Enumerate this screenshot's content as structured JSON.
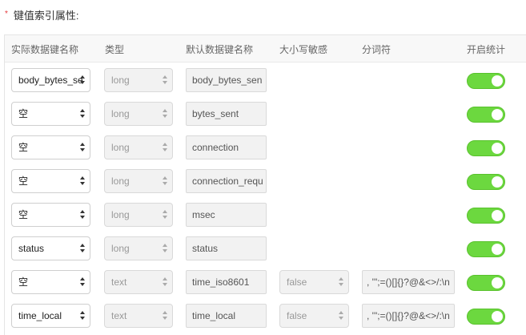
{
  "section": {
    "required_mark": "*",
    "label": "键值索引属性:"
  },
  "columns": {
    "field_name": "实际数据键名称",
    "type": "类型",
    "alias": "默认数据键名称",
    "case_sensitive": "大小写敏感",
    "delimiter": "分词符",
    "stats": "开启统计"
  },
  "rows": [
    {
      "field_name": "body_bytes_se",
      "type": "long",
      "alias": "body_bytes_sen",
      "case_sensitive": null,
      "delimiter": null,
      "stats": true
    },
    {
      "field_name": "空",
      "type": "long",
      "alias": "bytes_sent",
      "case_sensitive": null,
      "delimiter": null,
      "stats": true
    },
    {
      "field_name": "空",
      "type": "long",
      "alias": "connection",
      "case_sensitive": null,
      "delimiter": null,
      "stats": true
    },
    {
      "field_name": "空",
      "type": "long",
      "alias": "connection_requ",
      "case_sensitive": null,
      "delimiter": null,
      "stats": true
    },
    {
      "field_name": "空",
      "type": "long",
      "alias": "msec",
      "case_sensitive": null,
      "delimiter": null,
      "stats": true
    },
    {
      "field_name": "status",
      "type": "long",
      "alias": "status",
      "case_sensitive": null,
      "delimiter": null,
      "stats": true
    },
    {
      "field_name": "空",
      "type": "text",
      "alias": "time_iso8601",
      "case_sensitive": "false",
      "delimiter": ", '\";=()[]{}?@&<>/:\\n",
      "stats": true
    },
    {
      "field_name": "time_local",
      "type": "text",
      "alias": "time_local",
      "case_sensitive": "false",
      "delimiter": ", '\";=()[]{}?@&<>/:\\n",
      "stats": true
    }
  ],
  "colors": {
    "toggle_on": "#6cd83f",
    "required": "#e4393c"
  }
}
